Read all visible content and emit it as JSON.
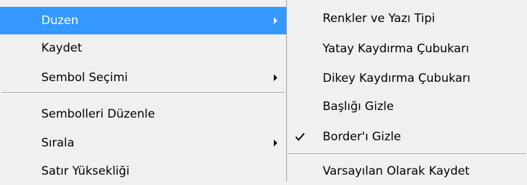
{
  "main_menu": {
    "items": [
      {
        "label": "Duzen",
        "highlighted": true,
        "has_submenu": true
      },
      {
        "label": "Kaydet",
        "has_submenu": false
      },
      {
        "label": "Sembol Seçimi",
        "has_submenu": true
      },
      {
        "label": "Sembolleri Düzenle",
        "has_submenu": false
      },
      {
        "label": "Sırala",
        "has_submenu": true
      },
      {
        "label": "Satır Yüksekliği",
        "has_submenu": false
      }
    ],
    "highlight_color": "#3399ff"
  },
  "sub_menu": {
    "items": [
      {
        "label": "Renkler ve Yazı Tipi"
      },
      {
        "label": "Yatay Kaydırma Çubukarı"
      },
      {
        "label": "Dikey Kaydırma Çubukarı"
      },
      {
        "label": "Başlığı Gizle"
      },
      {
        "label": "Border'ı Gizle",
        "checked": true
      },
      {
        "label": "Varsayılan Olarak Kaydet"
      }
    ]
  }
}
